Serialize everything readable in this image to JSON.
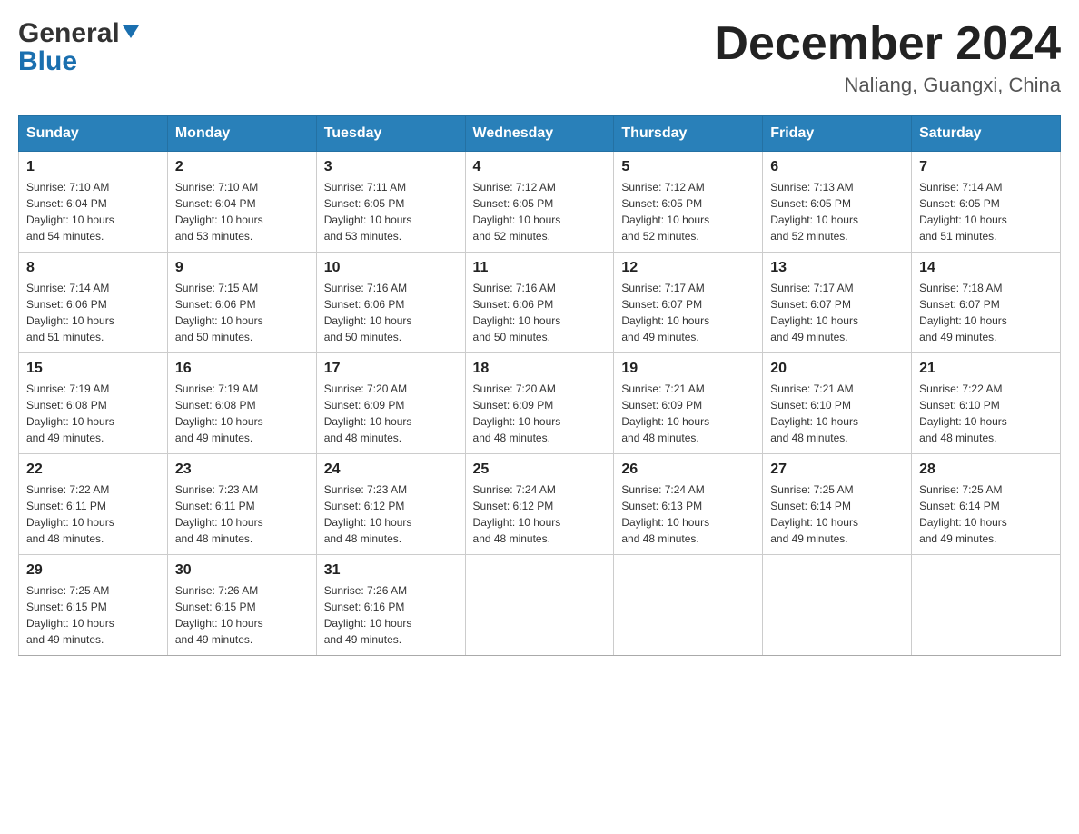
{
  "header": {
    "logo": {
      "general": "General",
      "blue": "Blue"
    },
    "title": "December 2024",
    "location": "Naliang, Guangxi, China"
  },
  "days_of_week": [
    "Sunday",
    "Monday",
    "Tuesday",
    "Wednesday",
    "Thursday",
    "Friday",
    "Saturday"
  ],
  "weeks": [
    [
      {
        "day": "1",
        "sunrise": "7:10 AM",
        "sunset": "6:04 PM",
        "daylight": "10 hours and 54 minutes."
      },
      {
        "day": "2",
        "sunrise": "7:10 AM",
        "sunset": "6:04 PM",
        "daylight": "10 hours and 53 minutes."
      },
      {
        "day": "3",
        "sunrise": "7:11 AM",
        "sunset": "6:05 PM",
        "daylight": "10 hours and 53 minutes."
      },
      {
        "day": "4",
        "sunrise": "7:12 AM",
        "sunset": "6:05 PM",
        "daylight": "10 hours and 52 minutes."
      },
      {
        "day": "5",
        "sunrise": "7:12 AM",
        "sunset": "6:05 PM",
        "daylight": "10 hours and 52 minutes."
      },
      {
        "day": "6",
        "sunrise": "7:13 AM",
        "sunset": "6:05 PM",
        "daylight": "10 hours and 52 minutes."
      },
      {
        "day": "7",
        "sunrise": "7:14 AM",
        "sunset": "6:05 PM",
        "daylight": "10 hours and 51 minutes."
      }
    ],
    [
      {
        "day": "8",
        "sunrise": "7:14 AM",
        "sunset": "6:06 PM",
        "daylight": "10 hours and 51 minutes."
      },
      {
        "day": "9",
        "sunrise": "7:15 AM",
        "sunset": "6:06 PM",
        "daylight": "10 hours and 50 minutes."
      },
      {
        "day": "10",
        "sunrise": "7:16 AM",
        "sunset": "6:06 PM",
        "daylight": "10 hours and 50 minutes."
      },
      {
        "day": "11",
        "sunrise": "7:16 AM",
        "sunset": "6:06 PM",
        "daylight": "10 hours and 50 minutes."
      },
      {
        "day": "12",
        "sunrise": "7:17 AM",
        "sunset": "6:07 PM",
        "daylight": "10 hours and 49 minutes."
      },
      {
        "day": "13",
        "sunrise": "7:17 AM",
        "sunset": "6:07 PM",
        "daylight": "10 hours and 49 minutes."
      },
      {
        "day": "14",
        "sunrise": "7:18 AM",
        "sunset": "6:07 PM",
        "daylight": "10 hours and 49 minutes."
      }
    ],
    [
      {
        "day": "15",
        "sunrise": "7:19 AM",
        "sunset": "6:08 PM",
        "daylight": "10 hours and 49 minutes."
      },
      {
        "day": "16",
        "sunrise": "7:19 AM",
        "sunset": "6:08 PM",
        "daylight": "10 hours and 49 minutes."
      },
      {
        "day": "17",
        "sunrise": "7:20 AM",
        "sunset": "6:09 PM",
        "daylight": "10 hours and 48 minutes."
      },
      {
        "day": "18",
        "sunrise": "7:20 AM",
        "sunset": "6:09 PM",
        "daylight": "10 hours and 48 minutes."
      },
      {
        "day": "19",
        "sunrise": "7:21 AM",
        "sunset": "6:09 PM",
        "daylight": "10 hours and 48 minutes."
      },
      {
        "day": "20",
        "sunrise": "7:21 AM",
        "sunset": "6:10 PM",
        "daylight": "10 hours and 48 minutes."
      },
      {
        "day": "21",
        "sunrise": "7:22 AM",
        "sunset": "6:10 PM",
        "daylight": "10 hours and 48 minutes."
      }
    ],
    [
      {
        "day": "22",
        "sunrise": "7:22 AM",
        "sunset": "6:11 PM",
        "daylight": "10 hours and 48 minutes."
      },
      {
        "day": "23",
        "sunrise": "7:23 AM",
        "sunset": "6:11 PM",
        "daylight": "10 hours and 48 minutes."
      },
      {
        "day": "24",
        "sunrise": "7:23 AM",
        "sunset": "6:12 PM",
        "daylight": "10 hours and 48 minutes."
      },
      {
        "day": "25",
        "sunrise": "7:24 AM",
        "sunset": "6:12 PM",
        "daylight": "10 hours and 48 minutes."
      },
      {
        "day": "26",
        "sunrise": "7:24 AM",
        "sunset": "6:13 PM",
        "daylight": "10 hours and 48 minutes."
      },
      {
        "day": "27",
        "sunrise": "7:25 AM",
        "sunset": "6:14 PM",
        "daylight": "10 hours and 49 minutes."
      },
      {
        "day": "28",
        "sunrise": "7:25 AM",
        "sunset": "6:14 PM",
        "daylight": "10 hours and 49 minutes."
      }
    ],
    [
      {
        "day": "29",
        "sunrise": "7:25 AM",
        "sunset": "6:15 PM",
        "daylight": "10 hours and 49 minutes."
      },
      {
        "day": "30",
        "sunrise": "7:26 AM",
        "sunset": "6:15 PM",
        "daylight": "10 hours and 49 minutes."
      },
      {
        "day": "31",
        "sunrise": "7:26 AM",
        "sunset": "6:16 PM",
        "daylight": "10 hours and 49 minutes."
      },
      null,
      null,
      null,
      null
    ]
  ],
  "labels": {
    "sunrise": "Sunrise:",
    "sunset": "Sunset:",
    "daylight": "Daylight:"
  }
}
